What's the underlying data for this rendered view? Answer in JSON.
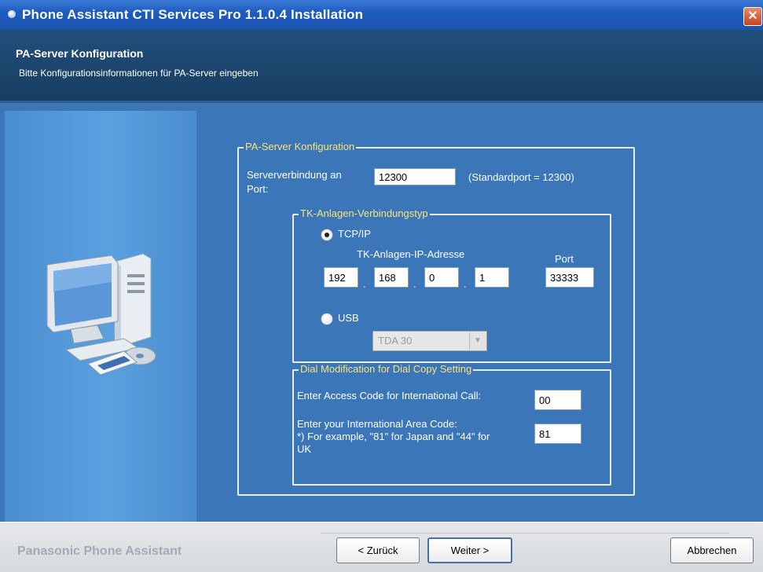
{
  "window": {
    "title": "Phone Assistant CTI Services Pro 1.1.0.4 Installation",
    "close_glyph": "✕"
  },
  "header": {
    "title": "PA-Server Konfiguration",
    "subtitle": "Bitte Konfigurationsinformationen für PA-Server eingeben"
  },
  "server_group": {
    "legend": "PA-Server Konfiguration",
    "port_label_line1": "Serververbindung an",
    "port_label_line2": "Port:",
    "port_value": "12300",
    "port_hint": "(Standardport = 12300)"
  },
  "tk_group": {
    "legend": "TK-Anlagen-Verbindungstyp",
    "tcp_label": "TCP/IP",
    "tcp_selected": true,
    "ip_label": "TK-Anlagen-IP-Adresse",
    "port_label": "Port",
    "ip": [
      "192",
      "168",
      "0",
      "1"
    ],
    "ip_sep": ".",
    "port_value": "33333",
    "usb_label": "USB",
    "usb_selected": false,
    "usb_select_value": "TDA 30"
  },
  "dial_group": {
    "legend": "Dial Modification for Dial Copy Setting",
    "access_label": "Enter Access Code for International Call:",
    "access_value": "00",
    "area_label_line1": "Enter your International Area Code:",
    "area_label_line2": "*) For example, \"81\" for Japan and \"44\" for",
    "area_label_line3": "UK",
    "area_value": "81"
  },
  "footer": {
    "brand": "Panasonic Phone Assistant",
    "back_label": "< Zurück",
    "next_label": "Weiter >",
    "cancel_label": "Abbrechen"
  },
  "icons": {
    "close": "close-icon",
    "computer": "computer-icon",
    "radio": "radio-icon",
    "dropdown": "chevron-down-icon"
  },
  "colors": {
    "titlebar": "#1f5cc0",
    "header": "#1b4369",
    "main": "#3b76b9",
    "legend": "#f8e37b"
  }
}
